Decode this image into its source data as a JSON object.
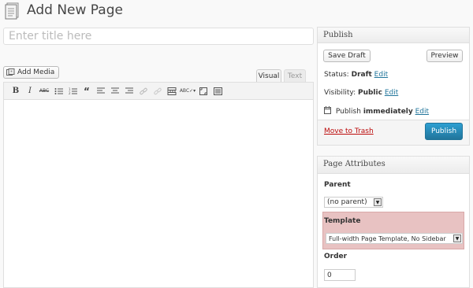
{
  "header": {
    "title": "Add New Page",
    "icon": "page-icon"
  },
  "title_input": {
    "placeholder": "Enter title here",
    "value": ""
  },
  "media": {
    "add_media_label": "Add Media",
    "icon": "media-icon"
  },
  "editor": {
    "tabs": [
      {
        "label": "Visual",
        "active": true
      },
      {
        "label": "Text",
        "active": false
      }
    ],
    "toolbar": [
      "bold",
      "italic",
      "strikethrough",
      "bulleted-list",
      "numbered-list",
      "blockquote",
      "align-left",
      "align-center",
      "align-right",
      "insert-link",
      "remove-link",
      "insert-more",
      "spellcheck",
      "fullscreen",
      "kitchen-sink"
    ]
  },
  "publish": {
    "title": "Publish",
    "save_draft_label": "Save Draft",
    "preview_label": "Preview",
    "status_label": "Status:",
    "status_value": "Draft",
    "visibility_label": "Visibility:",
    "visibility_value": "Public",
    "publish_label": "Publish",
    "publish_when": "immediately",
    "edit_label": "Edit",
    "move_to_trash_label": "Move to Trash",
    "publish_button_label": "Publish",
    "accent_color": "#21759b",
    "trash_color": "#bc0b0b"
  },
  "page_attributes": {
    "title": "Page Attributes",
    "parent_label": "Parent",
    "parent_value": "(no parent)",
    "template_label": "Template",
    "template_value": "Full-width Page Template, No Sidebar",
    "template_highlight_color": "#e8c2c2",
    "order_label": "Order",
    "order_value": "0"
  }
}
